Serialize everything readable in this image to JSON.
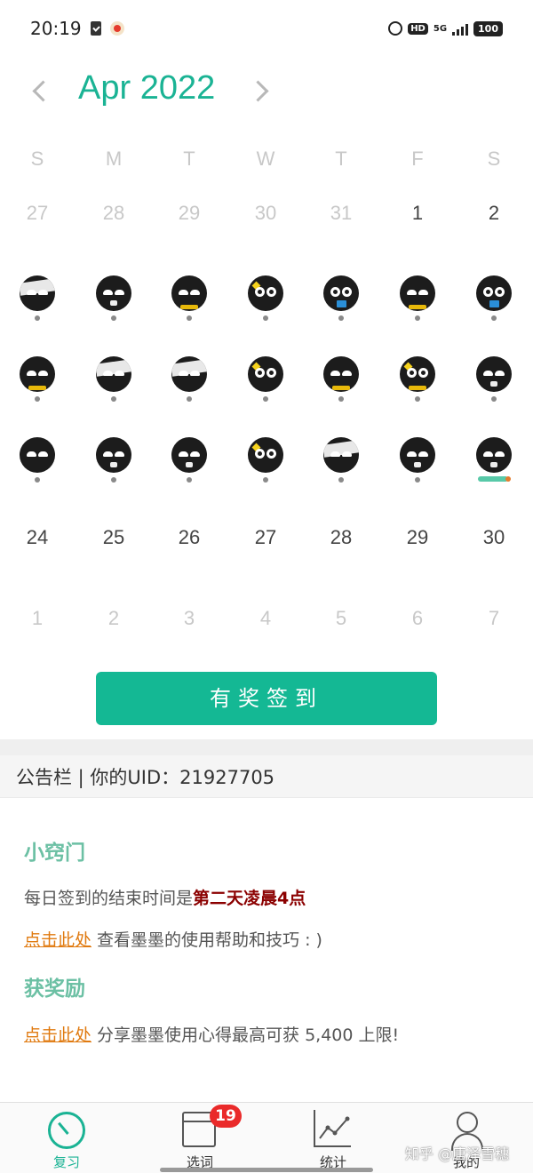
{
  "status_bar": {
    "time": "20:19",
    "hd_label": "HD",
    "network": "5G",
    "battery": "100"
  },
  "calendar": {
    "month_title": "Apr 2022",
    "weekdays": [
      "S",
      "M",
      "T",
      "W",
      "T",
      "F",
      "S"
    ],
    "row1": [
      "27",
      "28",
      "29",
      "30",
      "31",
      "1",
      "2"
    ],
    "row5": [
      "24",
      "25",
      "26",
      "27",
      "28",
      "29",
      "30"
    ],
    "row6": [
      "1",
      "2",
      "3",
      "4",
      "5",
      "6",
      "7"
    ]
  },
  "checkin_button": "有奖签到",
  "notice": {
    "bar_text": "公告栏 | 你的UID：21927705",
    "tips_title": "小窍门",
    "tips_line1_prefix": "每日签到的结束时间是",
    "tips_line1_emph": "第二天凌晨4点",
    "tips_link1": "点击此处",
    "tips_line2": " 查看墨墨的使用帮助和技巧 : )",
    "reward_title": "获奖励",
    "reward_link": "点击此处",
    "reward_line": " 分享墨墨使用心得最高可获 5,400 上限!"
  },
  "bottom_nav": {
    "review": "复习",
    "words": "选词",
    "words_badge": "19",
    "stats": "统计",
    "me": "我的"
  },
  "watermark": "知乎 @唐泽雪穗"
}
